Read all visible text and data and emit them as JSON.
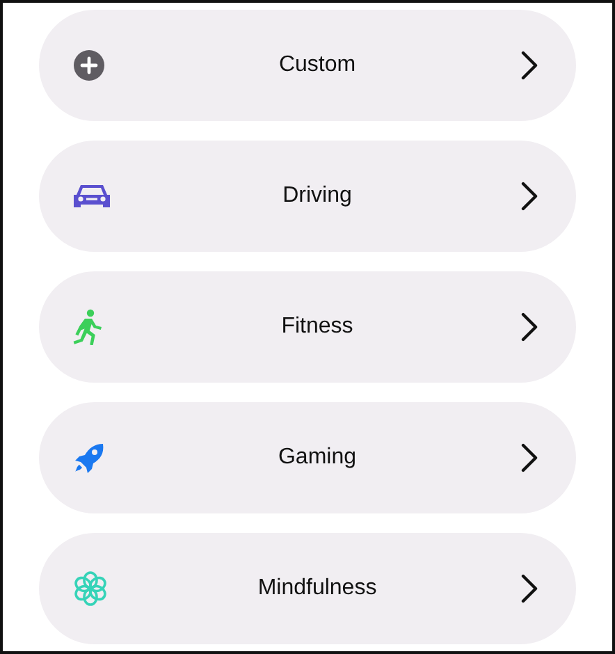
{
  "focus_modes": [
    {
      "label": "Custom",
      "kind": "plus",
      "color": "#5f5c62"
    },
    {
      "label": "Driving",
      "kind": "car",
      "color": "#5a4fcf"
    },
    {
      "label": "Fitness",
      "kind": "runner",
      "color": "#3ccf5a"
    },
    {
      "label": "Gaming",
      "kind": "rocket",
      "color": "#1a78f0"
    },
    {
      "label": "Mindfulness",
      "kind": "flower",
      "color": "#36d3b8"
    }
  ]
}
